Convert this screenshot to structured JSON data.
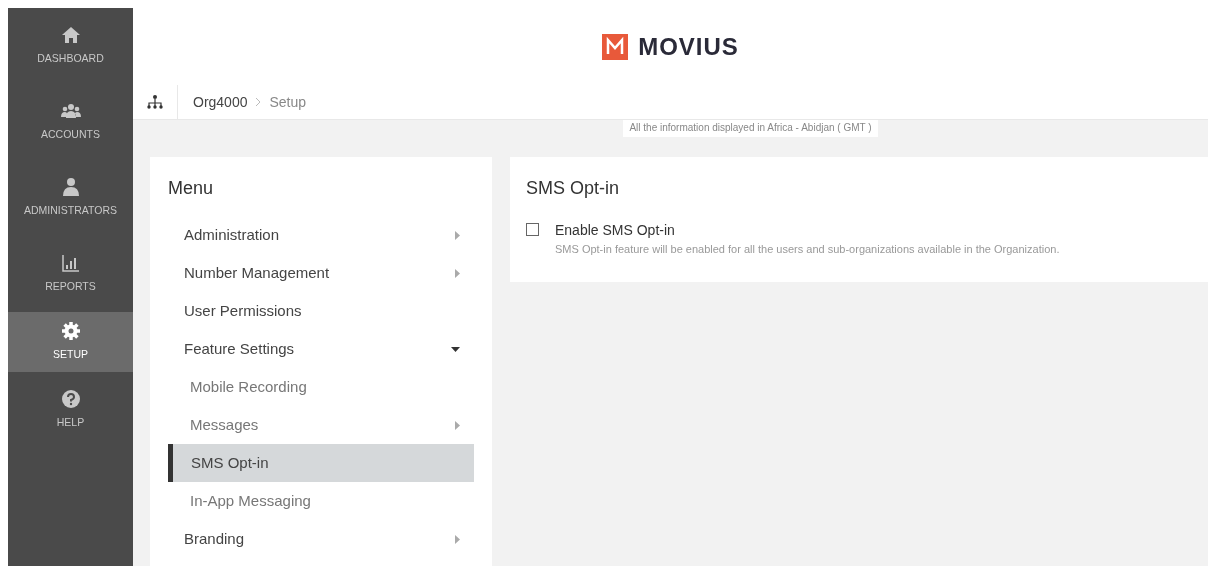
{
  "sidebar": {
    "items": [
      {
        "label": "DASHBOARD",
        "selected": false
      },
      {
        "label": "ACCOUNTS",
        "selected": false
      },
      {
        "label": "ADMINISTRATORS",
        "selected": false
      },
      {
        "label": "REPORTS",
        "selected": false
      },
      {
        "label": "SETUP",
        "selected": true
      },
      {
        "label": "HELP",
        "selected": false
      }
    ]
  },
  "header": {
    "logo_text": "MOVIUS"
  },
  "breadcrumb": [
    "Org4000",
    "Setup"
  ],
  "timezone_note": "All the information displayed in Africa - Abidjan ( GMT )",
  "menu": {
    "title": "Menu",
    "items": [
      {
        "label": "Administration",
        "kind": "folder",
        "expanded": false,
        "selected": false
      },
      {
        "label": "Number Management",
        "kind": "folder",
        "expanded": false,
        "selected": false
      },
      {
        "label": "User Permissions",
        "kind": "page",
        "selected": false
      },
      {
        "label": "Feature Settings",
        "kind": "folder",
        "expanded": true,
        "selected": false,
        "children": [
          {
            "label": "Mobile Recording",
            "kind": "page",
            "selected": false
          },
          {
            "label": "Messages",
            "kind": "folder",
            "expanded": false,
            "selected": false
          },
          {
            "label": "SMS Opt-in",
            "kind": "page",
            "selected": true
          },
          {
            "label": "In-App Messaging",
            "kind": "page",
            "selected": false
          }
        ]
      },
      {
        "label": "Branding",
        "kind": "folder",
        "expanded": false,
        "selected": false
      }
    ]
  },
  "panel": {
    "title": "SMS Opt-in",
    "option": {
      "label": "Enable SMS Opt-in",
      "checked": false,
      "description": "SMS Opt-in feature will be enabled for all the users and sub-organizations available in the Organization."
    }
  }
}
